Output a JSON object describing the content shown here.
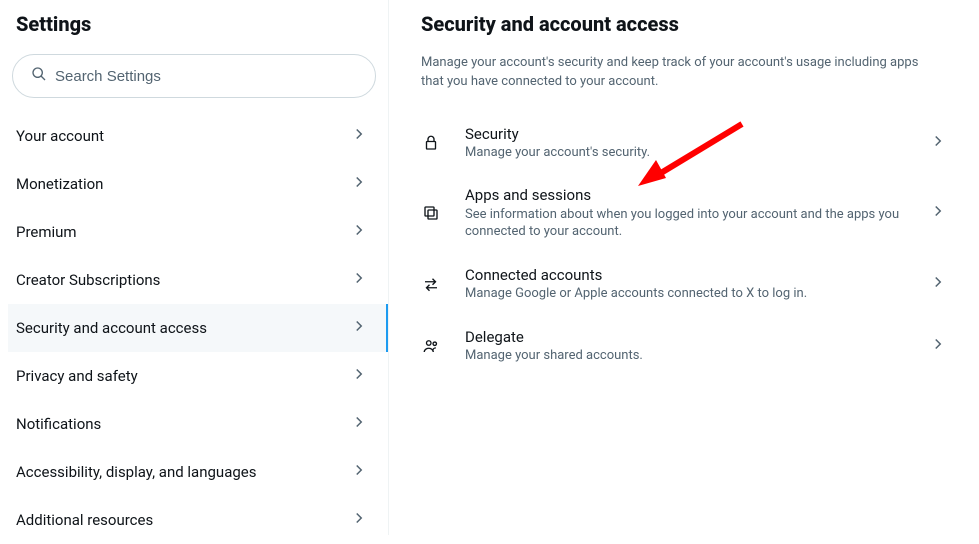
{
  "left": {
    "title": "Settings",
    "search_placeholder": "Search Settings",
    "items": [
      {
        "label": "Your account"
      },
      {
        "label": "Monetization"
      },
      {
        "label": "Premium"
      },
      {
        "label": "Creator Subscriptions"
      },
      {
        "label": "Security and account access"
      },
      {
        "label": "Privacy and safety"
      },
      {
        "label": "Notifications"
      },
      {
        "label": "Accessibility, display, and languages"
      },
      {
        "label": "Additional resources"
      }
    ]
  },
  "right": {
    "title": "Security and account access",
    "subtitle": "Manage your account's security and keep track of your account's usage including apps that you have connected to your account.",
    "rows": [
      {
        "title": "Security",
        "desc": "Manage your account's security."
      },
      {
        "title": "Apps and sessions",
        "desc": "See information about when you logged into your account and the apps you connected to your account."
      },
      {
        "title": "Connected accounts",
        "desc": "Manage Google or Apple accounts connected to X to log in."
      },
      {
        "title": "Delegate",
        "desc": "Manage your shared accounts."
      }
    ]
  }
}
